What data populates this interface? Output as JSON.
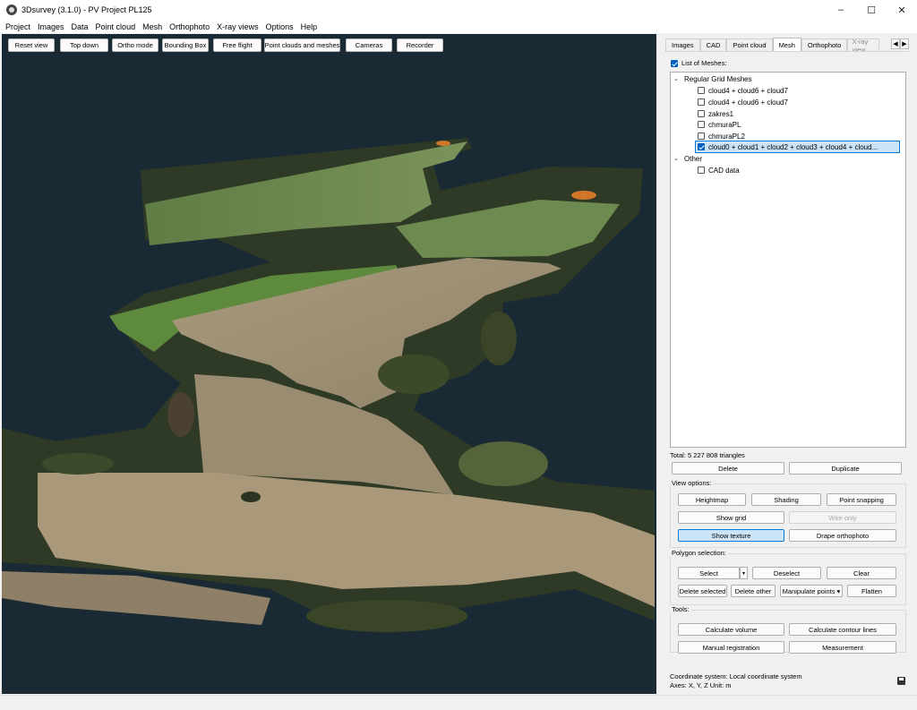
{
  "window": {
    "title": "3Dsurvey (3.1.0) - PV Project PL125",
    "controls": [
      "–",
      "☐",
      "✕"
    ]
  },
  "menu": [
    "Project",
    "Images",
    "Data",
    "Point cloud",
    "Mesh",
    "Orthophoto",
    "X-ray views",
    "Options",
    "Help"
  ],
  "viewport_toolbar": [
    "Reset view",
    "Top down",
    "Ortho mode",
    "Bounding Box",
    "Free flight",
    "Point clouds and meshes",
    "Cameras",
    "Recorder"
  ],
  "tabs": [
    "Images",
    "CAD",
    "Point cloud",
    "Mesh",
    "Orthophoto",
    "X-ray view"
  ],
  "active_tab": "Mesh",
  "mesh_panel": {
    "list_label": "List of Meshes:",
    "groups": [
      {
        "name": "Regular Grid Meshes",
        "items": [
          {
            "label": "cloud4 + cloud6 + cloud7",
            "checked": false
          },
          {
            "label": "cloud4 + cloud6 + cloud7",
            "checked": false
          },
          {
            "label": "zakres1",
            "checked": false
          },
          {
            "label": "chmuraPL",
            "checked": false
          },
          {
            "label": "chmuraPL2",
            "checked": false
          },
          {
            "label": "cloud0 + cloud1 + cloud2 + cloud3 + cloud4 + cloud...",
            "checked": true
          }
        ]
      },
      {
        "name": "Other",
        "items": [
          {
            "label": "CAD data",
            "checked": false
          }
        ]
      }
    ],
    "total": "Total: 5 227 808 triangles",
    "delete_label": "Delete",
    "duplicate_label": "Duplicate",
    "view_options": {
      "title": "View options:",
      "heightmap": "Heightmap",
      "shading": "Shading",
      "point_snapping": "Point snapping",
      "show_grid": "Show grid",
      "wire_only": "Wire only",
      "show_texture": "Show texture",
      "drape_orthophoto": "Drape orthophoto"
    },
    "polygon_selection": {
      "title": "Polygon selection:",
      "select": "Select",
      "deselect": "Deselect",
      "clear": "Clear",
      "delete_selected": "Delete selected",
      "delete_other": "Delete other",
      "manipulate_points": "Manipulate points ▾",
      "flatten": "Flatten"
    },
    "tools": {
      "title": "Tools:",
      "calculate_volume": "Calculate volume",
      "calculate_contour_lines": "Calculate contour lines",
      "manual_registration": "Manual registration",
      "measurement": "Measurement"
    },
    "status_line1": "Coordinate system: Local coordinate system",
    "status_line2": "Axes: X, Y, Z Unit: m"
  },
  "colors": {
    "viewport_bg": "#1a2a34",
    "accent": "#0078d7",
    "selection": "#cce4f7"
  }
}
